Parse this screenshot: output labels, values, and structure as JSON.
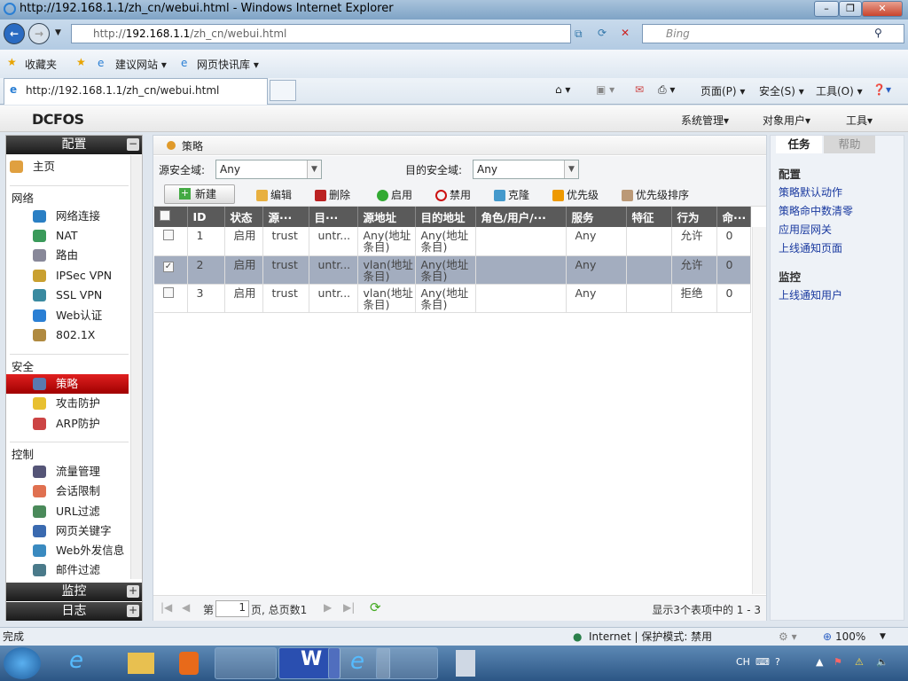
{
  "browser": {
    "window_title": "http://192.168.1.1/zh_cn/webui.html - Windows Internet Explorer",
    "address_prefix": "http://",
    "address_host": "192.168.1.1",
    "address_path": "/zh_cn/webui.html",
    "search_placeholder": "Bing",
    "favorites": [
      "收藏夹",
      "建议网站 ▾",
      "网页快讯库 ▾"
    ],
    "tab_title": "http://192.168.1.1/zh_cn/webui.html",
    "commands": [
      "页面(P) ▾",
      "安全(S) ▾",
      "工具(O) ▾"
    ],
    "status_left": "完成",
    "status_zone": "Internet | 保护模式: 禁用",
    "zoom": "100%"
  },
  "app": {
    "logo": "DCFOS",
    "top_menu": [
      "系统管理▾",
      "对象用户▾",
      "工具▾"
    ]
  },
  "sidebar": {
    "sections": [
      {
        "title": "配置",
        "toggle": "−"
      },
      {
        "title": "监控",
        "toggle": "+"
      },
      {
        "title": "日志",
        "toggle": "+"
      }
    ],
    "home": "主页",
    "groups": [
      {
        "label": "网络",
        "items": [
          "网络连接",
          "NAT",
          "路由",
          "IPSec VPN",
          "SSL VPN",
          "Web认证",
          "802.1X"
        ]
      },
      {
        "label": "安全",
        "items": [
          "策略",
          "攻击防护",
          "ARP防护"
        ]
      },
      {
        "label": "控制",
        "items": [
          "流量管理",
          "会话限制",
          "URL过滤",
          "网页关键字",
          "Web外发信息",
          "邮件过滤"
        ]
      }
    ],
    "active_item": "策略"
  },
  "main": {
    "breadcrumb": "策略",
    "filters": {
      "src_label": "源安全域:",
      "src_value": "Any",
      "dst_label": "目的安全域:",
      "dst_value": "Any"
    },
    "toolbar": [
      "新建",
      "编辑",
      "删除",
      "启用",
      "禁用",
      "克隆",
      "优先级",
      "优先级排序"
    ],
    "columns": [
      "",
      "ID",
      "状态",
      "源···",
      "目···",
      "源地址",
      "目的地址",
      "角色/用户/···",
      "服务",
      "特征",
      "行为",
      "命···"
    ],
    "rows": [
      {
        "checked": false,
        "id": "1",
        "status": "启用",
        "src": "trust",
        "dst": "untr...",
        "src_addr": "Any(地址条目)",
        "dst_addr": "Any(地址条目)",
        "role": "",
        "service": "Any",
        "feature": "",
        "action": "允许",
        "hits": "0"
      },
      {
        "checked": true,
        "id": "2",
        "status": "启用",
        "src": "trust",
        "dst": "untr...",
        "src_addr": "vlan(地址条目)",
        "dst_addr": "Any(地址条目)",
        "role": "",
        "service": "Any",
        "feature": "",
        "action": "允许",
        "hits": "0"
      },
      {
        "checked": false,
        "id": "3",
        "status": "启用",
        "src": "trust",
        "dst": "untr...",
        "src_addr": "vlan(地址条目)",
        "dst_addr": "Any(地址条目)",
        "role": "",
        "service": "Any",
        "feature": "",
        "action": "拒绝",
        "hits": "0"
      }
    ],
    "pager": {
      "prefix": "第",
      "page": "1",
      "suffix": "页, 总页数1",
      "summary": "显示3个表项中的 1 - 3"
    }
  },
  "right_panel": {
    "tabs": [
      "任务",
      "帮助"
    ],
    "config_heading": "配置",
    "config_links": [
      "策略默认动作",
      "策略命中数清零",
      "应用层网关",
      "上线通知页面"
    ],
    "monitor_heading": "监控",
    "monitor_links": [
      "上线通知用户"
    ]
  },
  "taskbar": {
    "lang": "CH"
  }
}
